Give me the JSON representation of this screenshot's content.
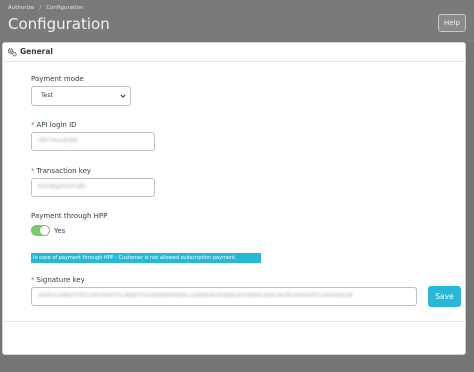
{
  "header": {
    "breadcrumb": [
      "Authorize",
      "Configuration"
    ],
    "title": "Configuration",
    "help_label": "Help"
  },
  "panel": {
    "title": "General",
    "payment_mode": {
      "label": "Payment mode",
      "value": "Test"
    },
    "api_login_id": {
      "label": "API login ID",
      "value": "7NYT4xmJEWB"
    },
    "transaction_key": {
      "label": "Transaction key",
      "value": "6A29Bg6HfDTvB5"
    },
    "payment_through_hpp": {
      "label": "Payment through HPP",
      "toggle_label": "Yes",
      "enabled": true
    },
    "info_note": "In case of payment through HPP - Customer is not allowed subscription payment.",
    "signature_key": {
      "label": "Signature key",
      "value": "2A3F1C44B97CFE23D07E97F3C2B6877A1E48B49F95BC1A0B9D4C0D88A2E47B6DF2E0C8A7B193F4A7E1C84A06D3B"
    },
    "save_label": "Save"
  },
  "colors": {
    "accent": "#25b9d7",
    "toggle_on": "#78c86e",
    "required": "#c05c67",
    "backdrop": "#757575"
  }
}
